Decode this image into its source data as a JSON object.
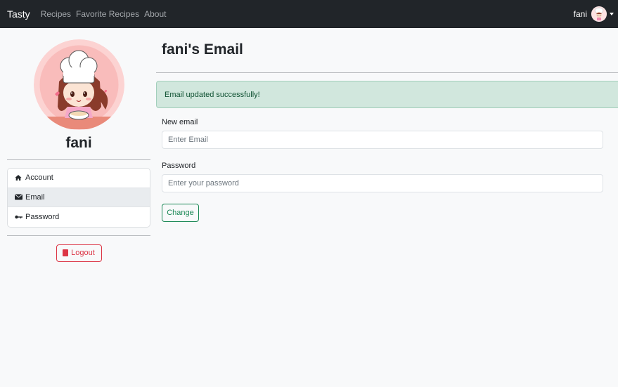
{
  "navbar": {
    "brand": "Tasty",
    "links": [
      "Recipes",
      "Favorite Recipes",
      "About"
    ],
    "username": "fani",
    "avatar_icon": "chef-avatar"
  },
  "sidebar": {
    "name": "fani",
    "items": [
      {
        "label": "Account",
        "icon": "house-icon"
      },
      {
        "label": "Email",
        "icon": "envelope-icon",
        "active": true
      },
      {
        "label": "Password",
        "icon": "key-icon"
      }
    ],
    "logout_label": "Logout"
  },
  "main": {
    "title": "fani's Email",
    "alert": "Email updated successfully!",
    "email_label": "New email",
    "email_placeholder": "Enter Email",
    "password_label": "Password",
    "password_placeholder": "Enter your password",
    "change_label": "Change"
  },
  "colors": {
    "navbar": "#212529",
    "success": "#198754",
    "danger": "#dc3545",
    "alert_bg": "#d1e7dd"
  }
}
